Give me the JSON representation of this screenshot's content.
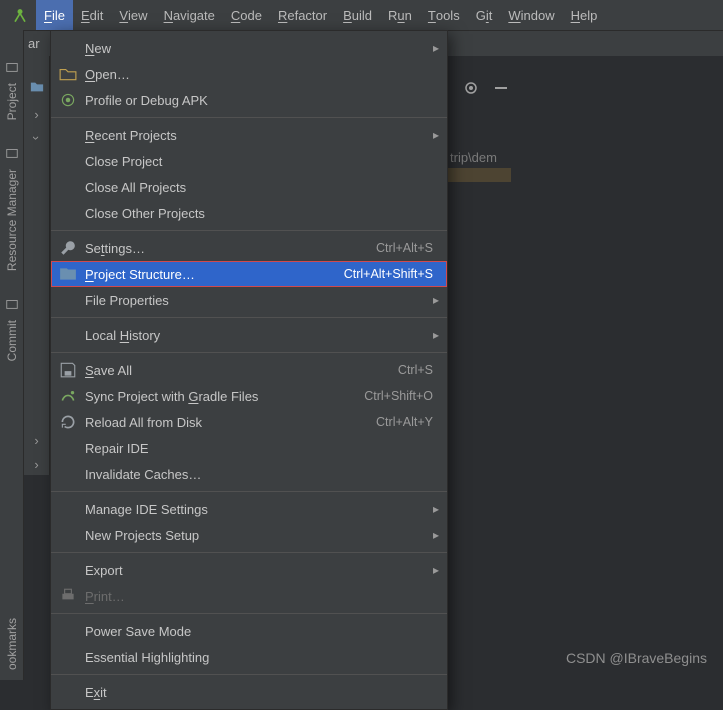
{
  "menubar": {
    "items": [
      {
        "label": "File",
        "mn": "F",
        "active": true
      },
      {
        "label": "Edit",
        "mn": "E"
      },
      {
        "label": "View",
        "mn": "V"
      },
      {
        "label": "Navigate",
        "mn": "N"
      },
      {
        "label": "Code",
        "mn": "C"
      },
      {
        "label": "Refactor",
        "mn": "R"
      },
      {
        "label": "Build",
        "mn": "B"
      },
      {
        "label": "Run",
        "mn": "u",
        "ulead": "R"
      },
      {
        "label": "Tools",
        "mn": "T"
      },
      {
        "label": "Git",
        "mn": "i",
        "ulead": "G"
      },
      {
        "label": "Window",
        "mn": "W"
      },
      {
        "label": "Help",
        "mn": "H"
      }
    ]
  },
  "toolbar": {
    "truncated": "ar"
  },
  "leftRail": {
    "items": [
      {
        "label": "Project",
        "icon": true
      },
      {
        "label": "Resource Manager",
        "icon": true
      },
      {
        "label": "Commit",
        "icon": true
      },
      {
        "label": "ookmarks",
        "icon": false
      }
    ]
  },
  "fileMenu": {
    "groups": [
      [
        {
          "label": "New",
          "mn": "N",
          "sub": true
        },
        {
          "label": "Open…",
          "mn": "O",
          "icon": "open-icon"
        },
        {
          "label": "Profile or Debug APK",
          "icon": "debug-icon"
        }
      ],
      [
        {
          "label": "Recent Projects",
          "mn": "R",
          "sub": true
        },
        {
          "label": "Close Project"
        },
        {
          "label": "Close All Projects"
        },
        {
          "label": "Close Other Projects"
        }
      ],
      [
        {
          "label": "Settings…",
          "mn": "t",
          "ulead": "Se",
          "icon": "wrench-icon",
          "shortcut": "Ctrl+Alt+S"
        },
        {
          "label": "Project Structure…",
          "mn": "P",
          "icon": "structure-icon",
          "shortcut": "Ctrl+Alt+Shift+S",
          "highlight": true,
          "boxed": true
        },
        {
          "label": "File Properties",
          "sub": true
        }
      ],
      [
        {
          "label": "Local History",
          "mn": "H",
          "ulead": "Local ",
          "sub": true
        }
      ],
      [
        {
          "label": "Save All",
          "mn": "S",
          "icon": "save-icon",
          "shortcut": "Ctrl+S"
        },
        {
          "label": "Sync Project with Gradle Files",
          "mn": "G",
          "ulead": "Sync Project with ",
          "icon": "gradle-icon",
          "shortcut": "Ctrl+Shift+O"
        },
        {
          "label": "Reload All from Disk",
          "icon": "reload-icon",
          "shortcut": "Ctrl+Alt+Y"
        },
        {
          "label": "Repair IDE"
        },
        {
          "label": "Invalidate Caches…"
        }
      ],
      [
        {
          "label": "Manage IDE Settings",
          "sub": true
        },
        {
          "label": "New Projects Setup",
          "sub": true
        }
      ],
      [
        {
          "label": "Export",
          "sub": true
        },
        {
          "label": "Print…",
          "mn": "P",
          "icon": "print-icon",
          "disabled": true
        }
      ],
      [
        {
          "label": "Power Save Mode"
        },
        {
          "label": "Essential Highlighting"
        }
      ],
      [
        {
          "label": "Exit",
          "mn": "x",
          "ulead": "E"
        }
      ]
    ]
  },
  "background": {
    "snippet": "trip\\dem",
    "toolbarIcons": [
      "gear-icon",
      "minimize-icon"
    ]
  },
  "watermark": "CSDN @IBraveBegins"
}
